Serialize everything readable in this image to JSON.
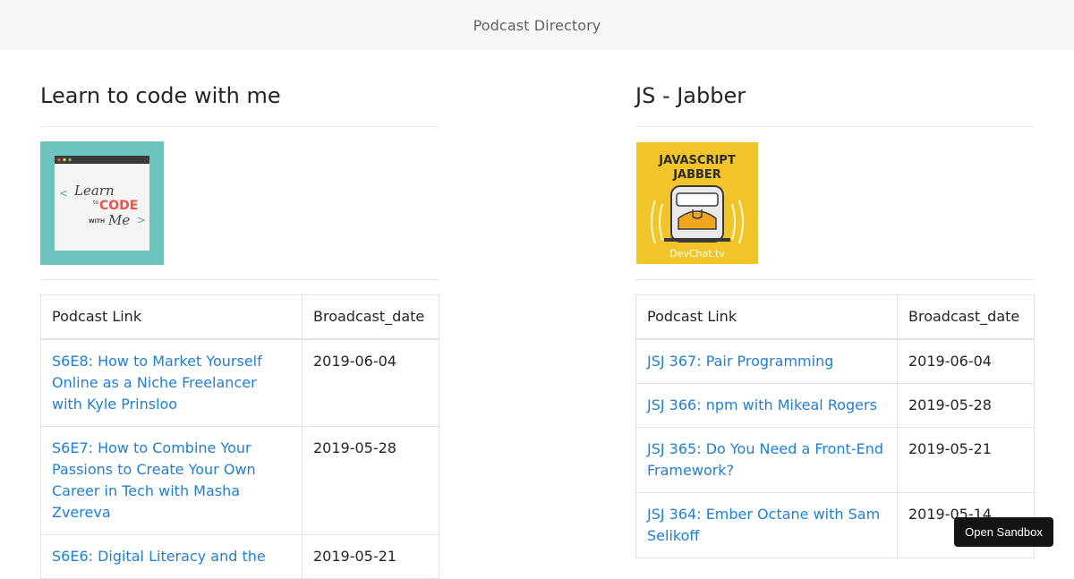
{
  "header": {
    "title": "Podcast Directory"
  },
  "podcasts": [
    {
      "title": "Learn to code with me",
      "cover": {
        "label_line1": "Learn",
        "label_to": "to",
        "label_code": "CODE",
        "label_with": "WITH",
        "label_me": "Me",
        "bg_color": "#6cc4bd"
      },
      "table": {
        "headers": [
          "Podcast Link",
          "Broadcast_date"
        ],
        "rows": [
          {
            "link": "S6E8: How to Market Yourself Online as a Niche Freelancer with Kyle Prinsloo",
            "date": "2019-06-04"
          },
          {
            "link": "S6E7: How to Combine Your Passions to Create Your Own Career in Tech with Masha Zvereva",
            "date": "2019-05-28"
          },
          {
            "link": "S6E6: Digital Literacy and the",
            "date": "2019-05-21"
          }
        ]
      }
    },
    {
      "title": "JS - Jabber",
      "cover": {
        "label_line1": "JAVASCRIPT",
        "label_line2": "JABBER",
        "label_footer": "DevChat.tv",
        "bg_color": "#f1c52a"
      },
      "table": {
        "headers": [
          "Podcast Link",
          "Broadcast_date"
        ],
        "rows": [
          {
            "link": "JSJ 367: Pair Programming",
            "date": "2019-06-04"
          },
          {
            "link": "JSJ 366: npm with Mikeal Rogers",
            "date": "2019-05-28"
          },
          {
            "link": "JSJ 365: Do You Need a Front-End Framework?",
            "date": "2019-05-21"
          },
          {
            "link": "JSJ 364: Ember Octane with Sam Selikoff",
            "date": "2019-05-14"
          }
        ]
      }
    }
  ],
  "sandbox": {
    "label": "Open Sandbox"
  },
  "colors": {
    "link": "#1e7fd6",
    "topbar_bg": "#f7f7f8"
  }
}
